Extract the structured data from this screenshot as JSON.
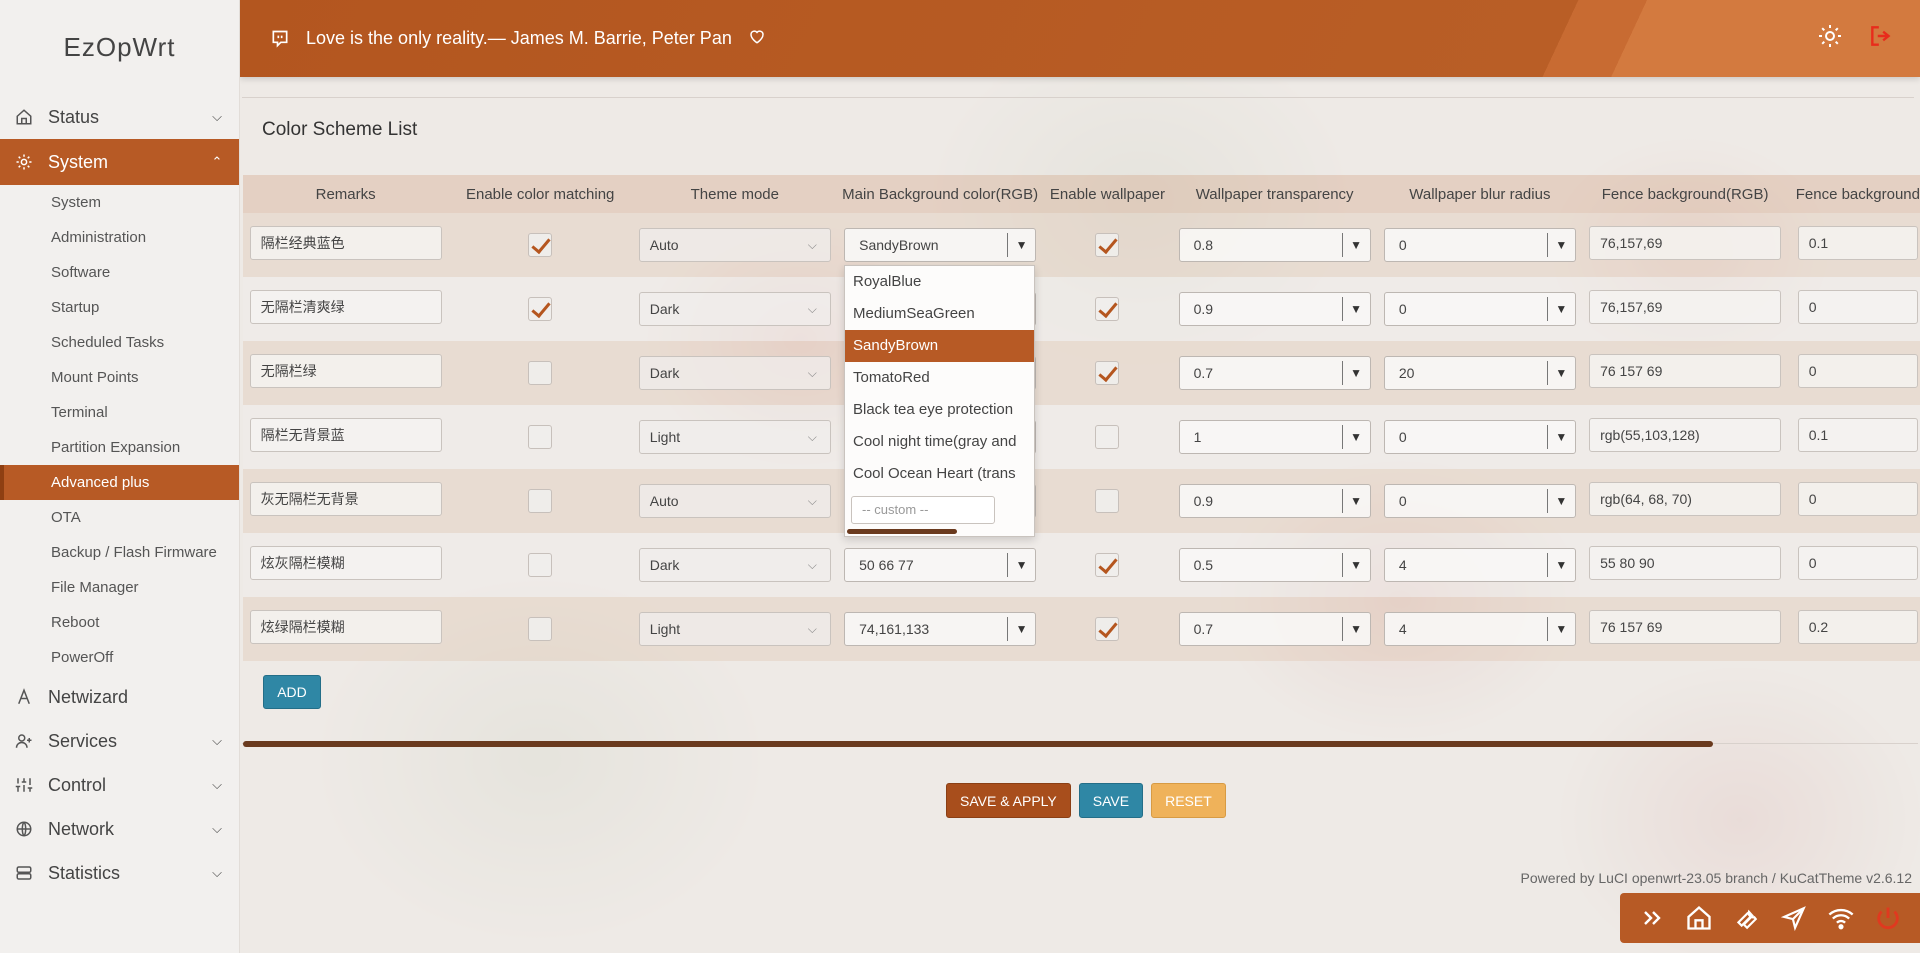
{
  "app": {
    "brand": "EzOpWrt"
  },
  "header": {
    "quote": "Love is the only reality.— James M. Barrie, Peter Pan",
    "accent": "#b75a25"
  },
  "sidebar": {
    "groups": [
      {
        "label": "Status",
        "icon": "home-icon"
      },
      {
        "label": "System",
        "icon": "gear-icon"
      }
    ],
    "system_items": [
      "System",
      "Administration",
      "Software",
      "Startup",
      "Scheduled Tasks",
      "Mount Points",
      "Terminal",
      "Partition Expansion",
      "Advanced plus",
      "OTA",
      "Backup / Flash Firmware",
      "File Manager",
      "Reboot",
      "PowerOff"
    ],
    "bottom_groups": [
      {
        "label": "Netwizard",
        "icon": "wizard-icon"
      },
      {
        "label": "Services",
        "icon": "services-icon"
      },
      {
        "label": "Control",
        "icon": "sliders-icon"
      },
      {
        "label": "Network",
        "icon": "globe-icon"
      },
      {
        "label": "Statistics",
        "icon": "database-icon"
      }
    ]
  },
  "main": {
    "section_title": "Color Scheme List",
    "columns": [
      "Remarks",
      "Enable color matching",
      "Theme mode",
      "Main Background color(RGB)",
      "Enable wallpaper",
      "Wallpaper transparency",
      "Wallpaper blur radius",
      "Fence background(RGB)",
      "Fence background"
    ],
    "rows": [
      {
        "remark": "隔栏经典蓝色",
        "color_match": true,
        "mode": "Auto",
        "main_bg": "SandyBrown",
        "wallpaper": true,
        "transparency": "0.8",
        "blur": "0",
        "fence_bg": "76,157,69",
        "fence_trans": "0.1"
      },
      {
        "remark": "无隔栏清爽绿",
        "color_match": true,
        "mode": "Dark",
        "main_bg": "",
        "wallpaper": true,
        "transparency": "0.9",
        "blur": "0",
        "fence_bg": "76,157,69",
        "fence_trans": "0"
      },
      {
        "remark": "无隔栏绿",
        "color_match": false,
        "mode": "Dark",
        "main_bg": "",
        "wallpaper": true,
        "transparency": "0.7",
        "blur": "20",
        "fence_bg": "76 157 69",
        "fence_trans": "0"
      },
      {
        "remark": "隔栏无背景蓝",
        "color_match": false,
        "mode": "Light",
        "main_bg": "",
        "wallpaper": false,
        "transparency": "1",
        "blur": "0",
        "fence_bg": "rgb(55,103,128)",
        "fence_trans": "0.1"
      },
      {
        "remark": "灰无隔栏无背景",
        "color_match": false,
        "mode": "Auto",
        "main_bg": "",
        "wallpaper": false,
        "transparency": "0.9",
        "blur": "0",
        "fence_bg": "rgb(64, 68, 70)",
        "fence_trans": "0"
      },
      {
        "remark": "炫灰隔栏模糊",
        "color_match": false,
        "mode": "Dark",
        "main_bg": "50 66 77",
        "wallpaper": true,
        "transparency": "0.5",
        "blur": "4",
        "fence_bg": "55 80 90",
        "fence_trans": "0"
      },
      {
        "remark": "炫绿隔栏模糊",
        "color_match": false,
        "mode": "Light",
        "main_bg": "74,161,133",
        "wallpaper": true,
        "transparency": "0.7",
        "blur": "4",
        "fence_bg": "76 157 69",
        "fence_trans": "0.2"
      }
    ],
    "dropdown": {
      "options": [
        "RoyalBlue",
        "MediumSeaGreen",
        "SandyBrown",
        "TomatoRed",
        "Black tea eye protection",
        "Cool night time(gray and",
        "Cool Ocean Heart (trans"
      ],
      "selected": "SandyBrown",
      "custom_placeholder": "-- custom --"
    },
    "add_label": "ADD",
    "buttons": {
      "save_apply": "SAVE & APPLY",
      "save": "SAVE",
      "reset": "RESET"
    },
    "footer": "Powered by LuCI openwrt-23.05 branch / KuCatTheme v2.6.12"
  },
  "quickbar": {
    "icons": [
      "double-chevron-icon",
      "home-icon",
      "wrench-icon",
      "send-icon",
      "wifi-icon",
      "power-icon"
    ]
  }
}
